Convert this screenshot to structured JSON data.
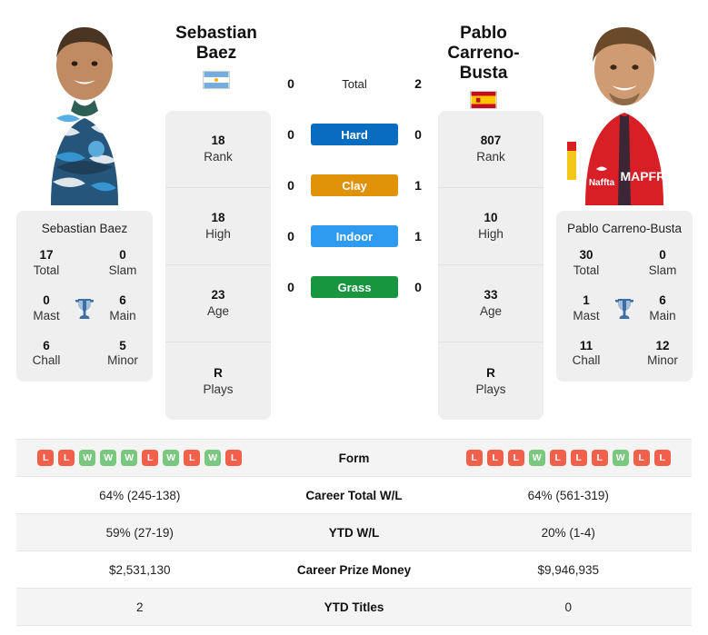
{
  "players": {
    "left": {
      "first_name": "Sebastian",
      "last_name": "Baez",
      "full_name": "Sebastian Baez",
      "country": "Argentina",
      "flag_icon": "argentina-flag-icon",
      "rank": "18",
      "rank_label": "Rank",
      "high": "18",
      "high_label": "High",
      "age": "23",
      "age_label": "Age",
      "plays": "R",
      "plays_label": "Plays",
      "titles": {
        "total": "17",
        "total_label": "Total",
        "slam": "0",
        "slam_label": "Slam",
        "mast": "0",
        "mast_label": "Mast",
        "main": "6",
        "main_label": "Main",
        "chall": "6",
        "chall_label": "Chall",
        "minor": "5",
        "minor_label": "Minor"
      },
      "form": [
        "L",
        "L",
        "W",
        "W",
        "W",
        "L",
        "W",
        "L",
        "W",
        "L"
      ],
      "career_total_wl": "64% (245-138)",
      "ytd_wl": "59% (27-19)",
      "career_prize_money": "$2,531,130",
      "ytd_titles": "2"
    },
    "right": {
      "first_name": "Pablo Carreno-",
      "last_name": "Busta",
      "full_name": "Pablo Carreno-Busta",
      "country": "Spain",
      "flag_icon": "spain-flag-icon",
      "rank": "807",
      "rank_label": "Rank",
      "high": "10",
      "high_label": "High",
      "age": "33",
      "age_label": "Age",
      "plays": "R",
      "plays_label": "Plays",
      "titles": {
        "total": "30",
        "total_label": "Total",
        "slam": "0",
        "slam_label": "Slam",
        "mast": "1",
        "mast_label": "Mast",
        "main": "6",
        "main_label": "Main",
        "chall": "11",
        "chall_label": "Chall",
        "minor": "12",
        "minor_label": "Minor"
      },
      "form": [
        "L",
        "L",
        "L",
        "W",
        "L",
        "L",
        "L",
        "W",
        "L",
        "L"
      ],
      "career_total_wl": "64% (561-319)",
      "ytd_wl": "20% (1-4)",
      "career_prize_money": "$9,946,935",
      "ytd_titles": "0"
    }
  },
  "head_to_head": [
    {
      "label": "Total",
      "left": "0",
      "right": "2",
      "style": "plain",
      "color": ""
    },
    {
      "label": "Hard",
      "left": "0",
      "right": "0",
      "style": "badge",
      "color": "#0a6cbf"
    },
    {
      "label": "Clay",
      "left": "0",
      "right": "1",
      "style": "badge",
      "color": "#e09209"
    },
    {
      "label": "Indoor",
      "left": "0",
      "right": "1",
      "style": "badge",
      "color": "#2e9bf0"
    },
    {
      "label": "Grass",
      "left": "0",
      "right": "0",
      "style": "badge",
      "color": "#17963f"
    }
  ],
  "stats_rows": [
    {
      "label": "Form",
      "left": "",
      "right": "",
      "type": "form"
    },
    {
      "label": "Career Total W/L",
      "left": "64% (245-138)",
      "right": "64% (561-319)",
      "type": "text"
    },
    {
      "label": "YTD W/L",
      "left": "59% (27-19)",
      "right": "20% (1-4)",
      "type": "text"
    },
    {
      "label": "Career Prize Money",
      "left": "$2,531,130",
      "right": "$9,946,935",
      "type": "text"
    },
    {
      "label": "YTD Titles",
      "left": "2",
      "right": "0",
      "type": "text"
    }
  ],
  "icons": {
    "trophy": "trophy-icon"
  },
  "colors": {
    "win": "#7ac77f",
    "loss": "#f1604a",
    "hard": "#0a6cbf",
    "clay": "#e09209",
    "indoor": "#2e9bf0",
    "grass": "#17963f",
    "trophy": "#3b6fa8",
    "panel": "#efefef"
  }
}
